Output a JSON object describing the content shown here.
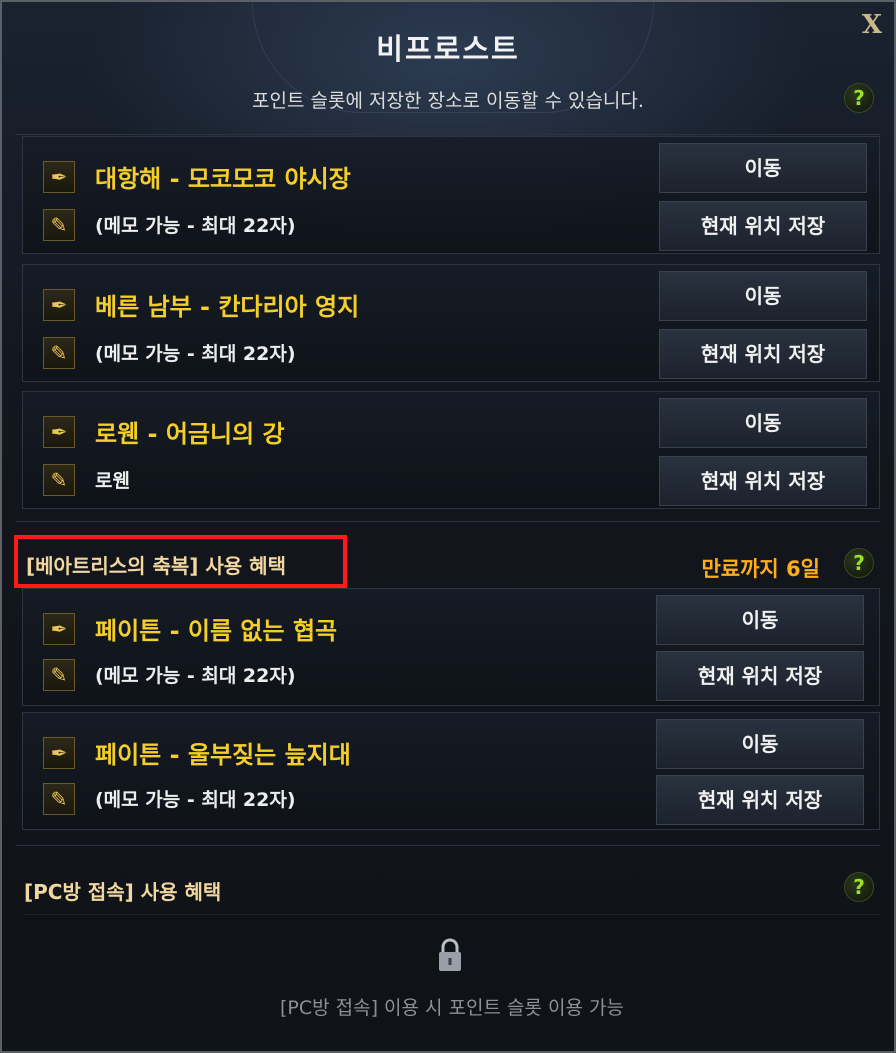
{
  "window": {
    "title": "비프로스트",
    "close_label": "X",
    "subtitle": "포인트 슬롯에 저장한 장소로 이동할 수 있습니다.",
    "help_label": "?"
  },
  "slots": [
    {
      "name": "대항해 - 모코모코 야시장",
      "memo": "(메모 가능 - 최대 22자)",
      "move_label": "이동",
      "save_label": "현재 위치 저장"
    },
    {
      "name": "베른 남부 - 칸다리아 영지",
      "memo": "(메모 가능 - 최대 22자)",
      "move_label": "이동",
      "save_label": "현재 위치 저장"
    },
    {
      "name": "로웬 - 어금니의 강",
      "memo": "로웬",
      "move_label": "이동",
      "save_label": "현재 위치 저장"
    }
  ],
  "beatrice": {
    "label": "[베아트리스의 축복] 사용 혜택",
    "expiry": "만료까지 6일",
    "help_label": "?",
    "slots": [
      {
        "name": "페이튼 - 이름 없는 협곡",
        "memo": "(메모 가능 - 최대 22자)",
        "move_label": "이동",
        "save_label": "현재 위치 저장"
      },
      {
        "name": "페이튼 - 울부짖는 늪지대",
        "memo": "(메모 가능 - 최대 22자)",
        "move_label": "이동",
        "save_label": "현재 위치 저장"
      }
    ]
  },
  "pcbang": {
    "label": "[PC방 접속] 사용 혜택",
    "help_label": "?",
    "locked_text": "[PC방 접속] 이용 시 포인트 슬롯 이용 가능"
  },
  "icons": {
    "pin": "quill-pin-icon",
    "memo": "edit-memo-icon",
    "lock": "lock-icon",
    "help": "help-icon"
  },
  "colors": {
    "slot_title": "#f4cf2a",
    "expiry": "#ffae1a",
    "help": "#9be02c",
    "highlight_box": "#ff1a1a"
  }
}
